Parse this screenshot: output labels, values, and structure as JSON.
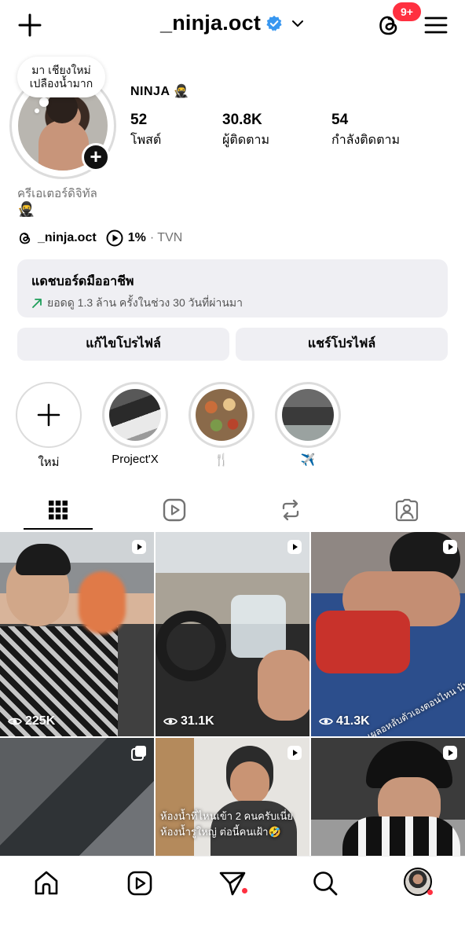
{
  "header": {
    "username": "_ninja.oct",
    "notification_count": "9+"
  },
  "profile": {
    "note": "มา เชียงใหม่ เปลืองน้ำมาก",
    "display_name": "NINJA 🥷",
    "stats": [
      {
        "value": "52",
        "label": "โพสต์"
      },
      {
        "value": "30.8K",
        "label": "ผู้ติดตาม"
      },
      {
        "value": "54",
        "label": "กำลังติดตาม"
      }
    ],
    "category": "ครีเอเตอร์ดิจิทัล",
    "bio": "🥷",
    "threads_handle": "_ninja.oct",
    "music_percent": "1%",
    "music_source": "· TVN"
  },
  "dashboard": {
    "title": "แดชบอร์ดมืออาชีพ",
    "subtitle": "ยอดดู 1.3 ล้าน ครั้งในช่วง 30 วันที่ผ่านมา"
  },
  "buttons": {
    "edit_profile": "แก้ไขโปรไฟล์",
    "share_profile": "แชร์โปรไฟล์"
  },
  "highlights": [
    {
      "label": "ใหม่",
      "icon": "plus-icon"
    },
    {
      "label": "Project'X"
    },
    {
      "label": "🍴"
    },
    {
      "label": "✈️"
    }
  ],
  "tabs": [
    "grid-icon",
    "reels-icon",
    "repost-icon",
    "tagged-icon"
  ],
  "posts": [
    {
      "type": "reel",
      "views": "225K"
    },
    {
      "type": "reel",
      "views": "31.1K"
    },
    {
      "type": "reel",
      "views": "41.3K",
      "caption": "เผลอหลับตัวเองตอนไหน นับแล้วหรอวะ 🤣"
    },
    {
      "type": "carousel"
    },
    {
      "type": "reel",
      "caption_line1": "ห้องน้ำที่ไหนเข้า 2 คนครับเนี่ย",
      "caption_line2": "ห้องน้ำรูใหญ่ ต่อนี้คนเฝ้า🤣"
    },
    {
      "type": "reel"
    }
  ],
  "colors": {
    "accent_red": "#ff3040",
    "verified_blue": "#3897f0",
    "button_bg": "#efeff3",
    "secondary_text": "#737373"
  }
}
